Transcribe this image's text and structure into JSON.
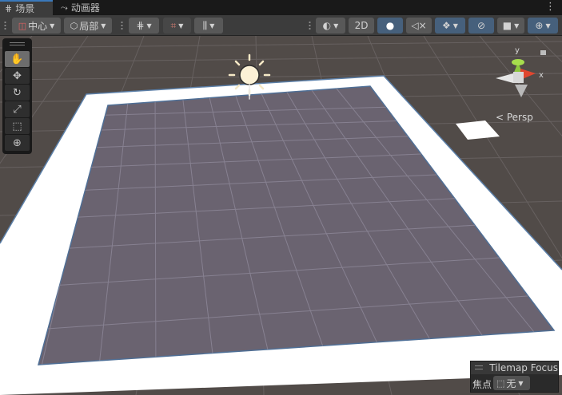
{
  "tabs": [
    {
      "label": "场景",
      "icon": "grid-icon",
      "active": true
    },
    {
      "label": "动画器",
      "icon": "animator-icon",
      "active": false
    }
  ],
  "toolbar": {
    "pivot_label": "中心",
    "handle_label": "局部",
    "view_2d_label": "2D"
  },
  "tools": [
    "hand-icon",
    "move-icon",
    "rotate-icon",
    "scale-icon",
    "rect-icon",
    "transform-icon"
  ],
  "gizmo": {
    "y_label": "y",
    "x_label": "x",
    "persp_label": "< Persp"
  },
  "tilemap": {
    "title": "Tilemap Focus",
    "focus_label": "焦点",
    "focus_value": "无"
  },
  "colors": {
    "accent": "#3a79bb",
    "toggle_on": "#46607c",
    "ground": "#514b48",
    "plane": "#6a6370"
  }
}
